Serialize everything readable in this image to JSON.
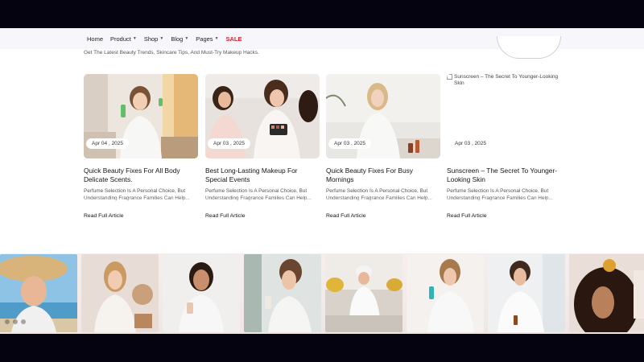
{
  "nav": {
    "items": [
      {
        "label": "Home",
        "dropdown": false
      },
      {
        "label": "Product",
        "dropdown": true
      },
      {
        "label": "Shop",
        "dropdown": true
      },
      {
        "label": "Blog",
        "dropdown": true
      },
      {
        "label": "Pages",
        "dropdown": true
      },
      {
        "label": "SALE",
        "dropdown": false
      }
    ],
    "sale_color": "#e0222f"
  },
  "blog": {
    "subtitle": "Get The Latest Beauty Trends, Skincare Tips, And Must-Try Makeup Hacks.",
    "cards": [
      {
        "date": "Apr 04 , 2025",
        "title": "Quick Beauty Fixes For All Body Delicate Scents.",
        "excerpt": "Perfume Selection Is A Personal Choice, But Understanding Fragrance Families Can Help...",
        "read_more": "Read Full Article"
      },
      {
        "date": "Apr 03 , 2025",
        "title": "Best Long-Lasting Makeup For Special Events",
        "excerpt": "Perfume Selection Is A Personal Choice, But Understanding Fragrance Families Can Help...",
        "read_more": "Read Full Article"
      },
      {
        "date": "Apr 03 , 2025",
        "title": "Quick Beauty Fixes For Busy Mornings",
        "excerpt": "Perfume Selection Is A Personal Choice, But Understanding Fragrance Families Can Help...",
        "read_more": "Read Full Article"
      },
      {
        "date": "Apr 03 , 2025",
        "title": "Sunscreen – The Secret To Younger-Looking Skin",
        "excerpt": "Perfume Selection Is A Personal Choice, But Understanding Fragrance Families Can Help...",
        "read_more": "Read Full Article",
        "image_alt": "Sunscreen – The Secret To Younger-Looking Skin"
      }
    ]
  }
}
